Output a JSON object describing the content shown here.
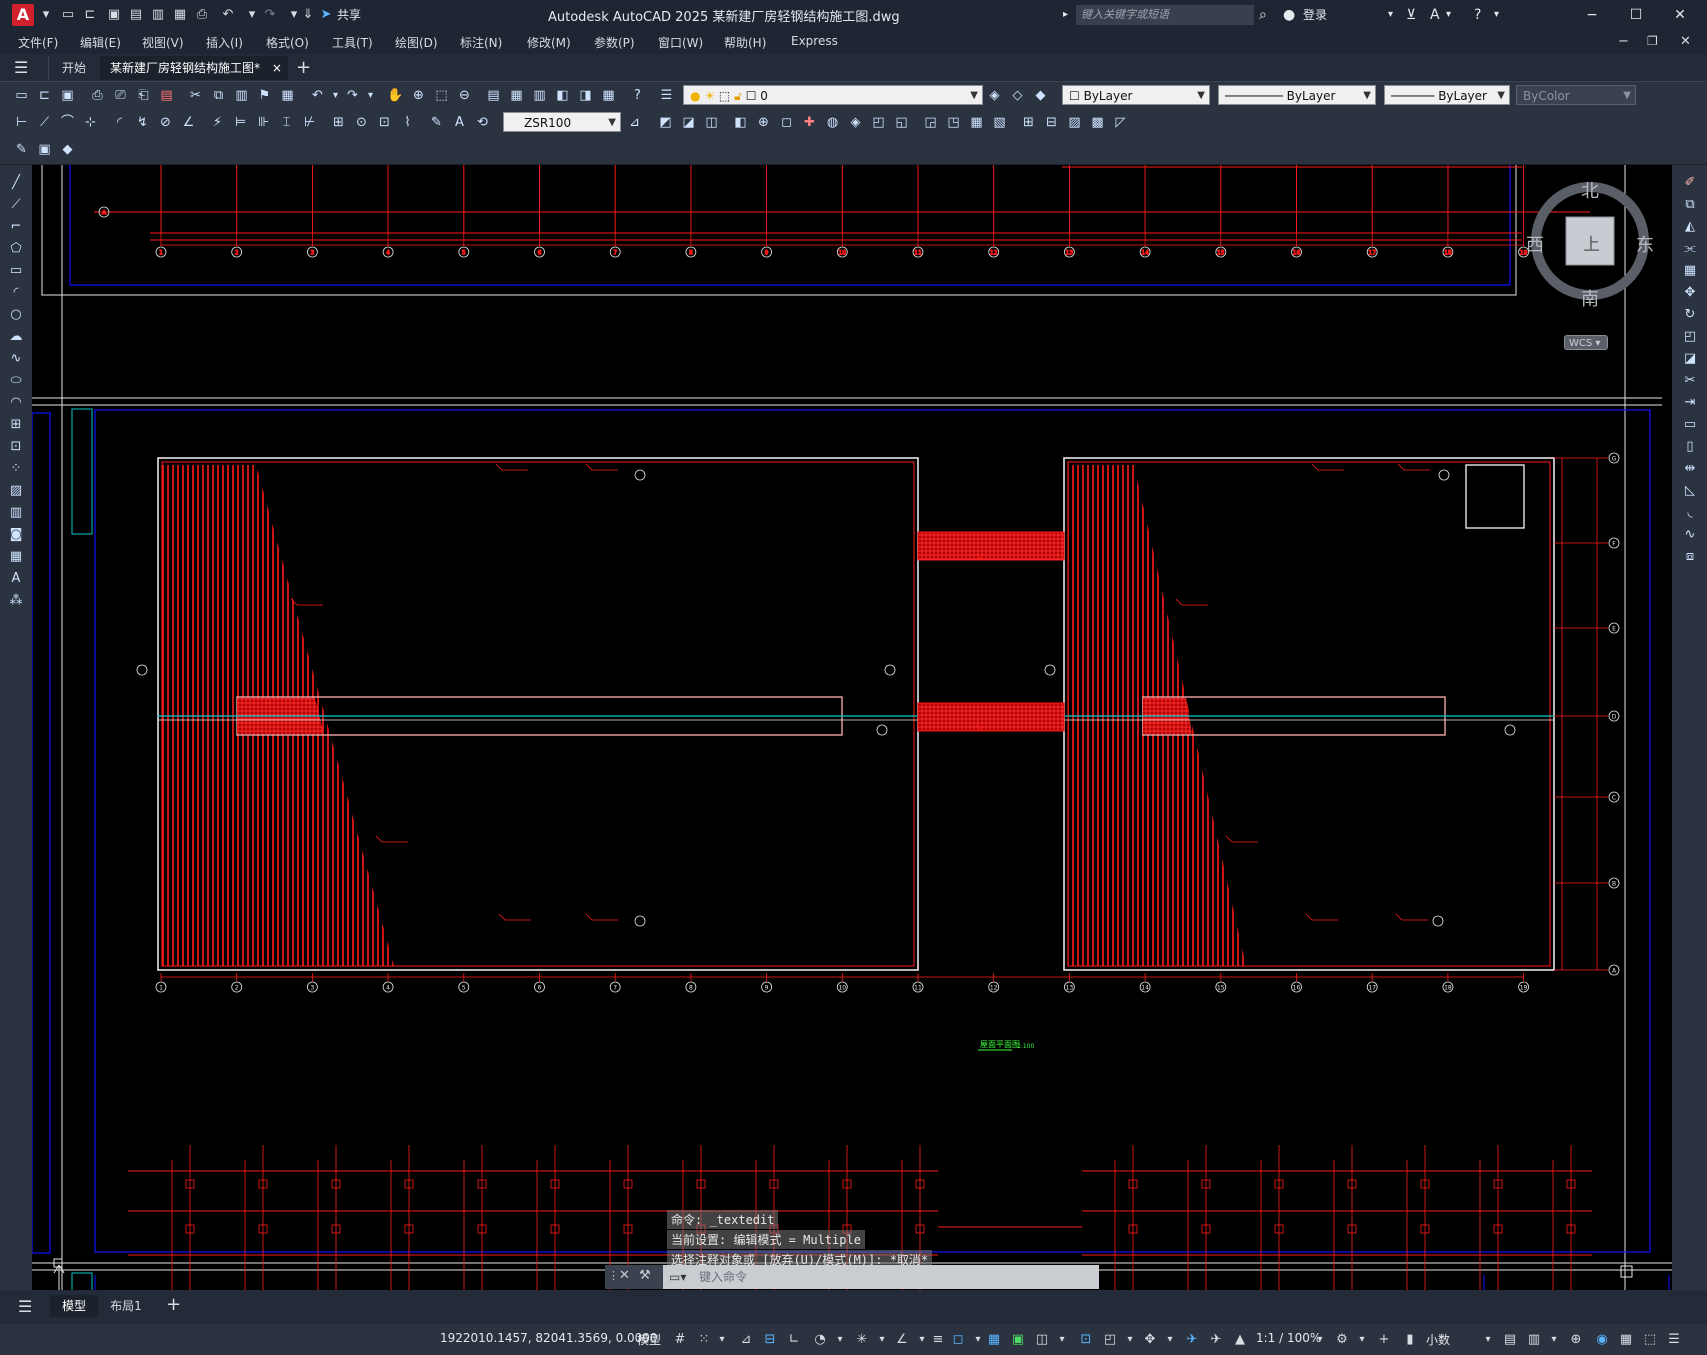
{
  "app": {
    "title": "Autodesk AutoCAD 2025    某新建厂房轻钢结构施工图.dwg",
    "logo": "A",
    "share": "共享",
    "search_placeholder": "键入关键字或短语",
    "login": "登录"
  },
  "menu": [
    "文件(F)",
    "编辑(E)",
    "视图(V)",
    "插入(I)",
    "格式(O)",
    "工具(T)",
    "绘图(D)",
    "标注(N)",
    "修改(M)",
    "参数(P)",
    "窗口(W)",
    "帮助(H)",
    "Express"
  ],
  "tabs": {
    "start": "开始",
    "active": "某新建厂房轻钢结构施工图*",
    "close": "×",
    "add": "+"
  },
  "toolbar": {
    "layer_current": "0",
    "color": "ByLayer",
    "linetype": "ByLayer",
    "lineweight": "ByLayer",
    "plotstyle": "ByColor",
    "dimstyle": "ZSR100"
  },
  "viewcube": {
    "north": "北",
    "south": "南",
    "east": "东",
    "west": "西",
    "face": "上",
    "wcs": "WCS"
  },
  "drawing": {
    "top_axis_labels": [
      "1",
      "2",
      "3",
      "4",
      "5",
      "6",
      "7",
      "8",
      "9",
      "10",
      "11",
      "12",
      "13",
      "14",
      "15",
      "16",
      "17",
      "18",
      "19"
    ],
    "bottom_axis_labels": [
      "1",
      "2",
      "3",
      "4",
      "5",
      "6",
      "7",
      "8",
      "9",
      "10",
      "11",
      "12",
      "13",
      "14",
      "15",
      "16",
      "17",
      "18",
      "19"
    ],
    "right_axis_labels": [
      "G",
      "F",
      "E",
      "D",
      "C",
      "B",
      "A"
    ],
    "plan_caption": "屋面平面图",
    "plan_scale": "1:100",
    "left_axis_top": "A"
  },
  "command": {
    "lines": [
      "命令: _textedit",
      "当前设置: 编辑模式 = Multiple",
      "选择注释对象或 [放弃(U)/模式(M)]: *取消*"
    ],
    "placeholder": "键入命令"
  },
  "layouts": {
    "model": "模型",
    "layout1": "布局1",
    "add": "+"
  },
  "status": {
    "coords": "1922010.1457, 82041.3569, 0.0000",
    "space": "模型",
    "scale": "1:1 / 100%",
    "units": "小数"
  },
  "colors": {
    "accent_red": "#ff1a1a",
    "frame_blue": "#1010ff",
    "frame_white": "#e6e6e6",
    "label_green": "#3cff3c"
  }
}
